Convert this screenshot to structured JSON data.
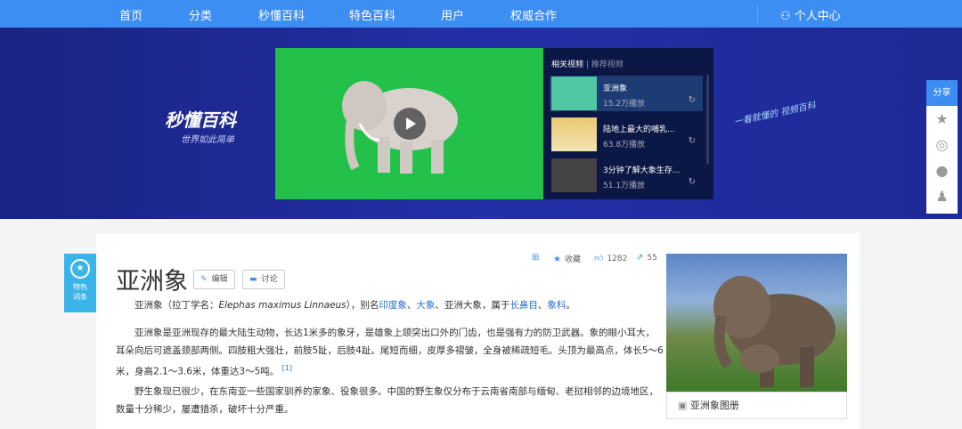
{
  "nav": {
    "items": [
      "首页",
      "分类",
      "秒懂百科",
      "特色百科",
      "用户",
      "权威合作"
    ],
    "user": "个人中心"
  },
  "banner": {
    "logo": "秒懂百科",
    "slogan": "世界如此简单",
    "handwriting": "一看就懂的 视频百科"
  },
  "video_panel": {
    "tab_active": "相关视频",
    "tab_other": "推荐视频",
    "items": [
      {
        "title": "亚洲象",
        "plays": "15.2万播放"
      },
      {
        "title": "陆地上最大的哺乳...",
        "plays": "63.8万播放"
      },
      {
        "title": "3分钟了解大象生存...",
        "plays": "51.1万播放"
      }
    ]
  },
  "share": {
    "label": "分享"
  },
  "badge": {
    "label1": "特色",
    "label2": "词条"
  },
  "entry": {
    "title": "亚洲象",
    "edit": "编辑",
    "discuss": "讨论",
    "collect": "收藏",
    "likes": "1282",
    "shares": "55",
    "p1": {
      "a": "亚洲象（拉丁学名：",
      "latin": "Elephas maximus Linnaeus",
      "b": "），别名",
      "l1": "印度象",
      "s1": "、",
      "l2": "大象",
      "c": "、亚洲大象，属于",
      "l3": "长鼻目",
      "s2": "、",
      "l4": "象科",
      "d": "。"
    },
    "p2": "亚洲象是亚洲现存的最大陆生动物，长达1米多的象牙，是雄象上颌突出口外的门齿，也是强有力的防卫武器。象的眼小耳大，耳朵向后可遮盖颈部两侧。四肢粗大强壮，前肢5趾，后肢4趾。尾短而细，皮厚多褶皱，全身被稀疏短毛。头顶为最高点，体长5～6米，身高2.1～3.6米，体重达3～5吨。",
    "ref": "[1]",
    "p3": "野生象现已很少，在东南亚一些国家驯养的家象、役象很多。中国的野生象仅分布于云南省南部与缅甸、老挝相邻的边境地区，数量十分稀少，屡遭猎杀，破坏十分严重。",
    "album": "亚洲象图册"
  }
}
